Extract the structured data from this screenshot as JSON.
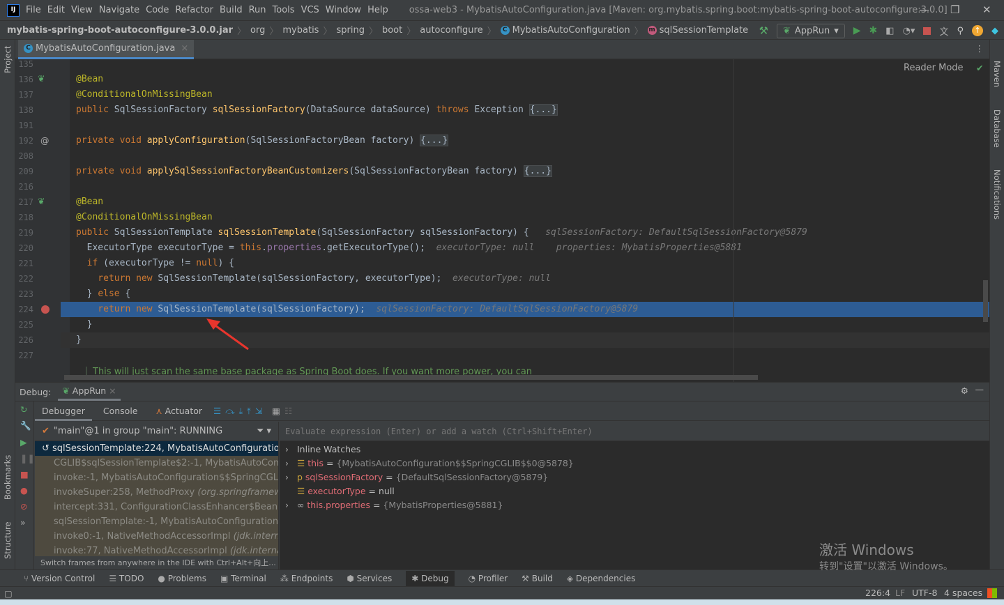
{
  "window": {
    "title": "ossa-web3 - MybatisAutoConfiguration.java [Maven: org.mybatis.spring.boot:mybatis-spring-boot-autoconfigure:3.0.0]",
    "logo": "IJ"
  },
  "menu": [
    "File",
    "Edit",
    "View",
    "Navigate",
    "Code",
    "Refactor",
    "Build",
    "Run",
    "Tools",
    "VCS",
    "Window",
    "Help"
  ],
  "breadcrumb": [
    "mybatis-spring-boot-autoconfigure-3.0.0.jar",
    "org",
    "mybatis",
    "spring",
    "boot",
    "autoconfigure",
    "MybatisAutoConfiguration",
    "sqlSessionTemplate"
  ],
  "run_config": "AppRun",
  "editor": {
    "tab": "MybatisAutoConfiguration.java",
    "reader_mode": "Reader Mode",
    "lines": [
      {
        "n": "135",
        "t": []
      },
      {
        "n": "136",
        "t": [
          [
            "ann",
            "@Bean"
          ]
        ]
      },
      {
        "n": "137",
        "t": [
          [
            "ann",
            "@ConditionalOnMissingBean"
          ]
        ]
      },
      {
        "n": "138",
        "t": [
          [
            "kw",
            "public "
          ],
          [
            "pl",
            "SqlSessionFactory "
          ],
          [
            "fn",
            "sqlSessionFactory"
          ],
          [
            "pl",
            "(DataSource dataSource) "
          ],
          [
            "kw",
            "throws "
          ],
          [
            "pl",
            "Exception "
          ],
          [
            "fold",
            "{...}"
          ]
        ]
      },
      {
        "n": "191",
        "t": []
      },
      {
        "n": "192",
        "t": [
          [
            "kw",
            "private void "
          ],
          [
            "fn",
            "applyConfiguration"
          ],
          [
            "pl",
            "(SqlSessionFactoryBean factory) "
          ],
          [
            "fold",
            "{...}"
          ]
        ]
      },
      {
        "n": "208",
        "t": []
      },
      {
        "n": "209",
        "t": [
          [
            "kw",
            "private void "
          ],
          [
            "fn",
            "applySqlSessionFactoryBeanCustomizers"
          ],
          [
            "pl",
            "(SqlSessionFactoryBean factory) "
          ],
          [
            "fold",
            "{...}"
          ]
        ]
      },
      {
        "n": "216",
        "t": []
      },
      {
        "n": "217",
        "t": [
          [
            "ann",
            "@Bean"
          ]
        ]
      },
      {
        "n": "218",
        "t": [
          [
            "ann",
            "@ConditionalOnMissingBean"
          ]
        ]
      },
      {
        "n": "219",
        "t": [
          [
            "kw",
            "public "
          ],
          [
            "pl",
            "SqlSessionTemplate "
          ],
          [
            "fn",
            "sqlSessionTemplate"
          ],
          [
            "pl",
            "(SqlSessionFactory sqlSessionFactory) {   "
          ],
          [
            "hint",
            "sqlSessionFactory: DefaultSqlSessionFactory@5879"
          ]
        ]
      },
      {
        "n": "220",
        "t": [
          [
            "pl",
            "  ExecutorType executorType = "
          ],
          [
            "kw",
            "this"
          ],
          [
            "pl",
            "."
          ],
          [
            "fld",
            "properties"
          ],
          [
            "pl",
            ".getExecutorType();  "
          ],
          [
            "kw",
            ""
          ],
          [
            "hint",
            "executorType: null    properties: MybatisProperties@5881"
          ]
        ]
      },
      {
        "n": "221",
        "t": [
          [
            "kw",
            "  if "
          ],
          [
            "pl",
            "(executorType != "
          ],
          [
            "kw",
            "null"
          ],
          [
            "pl",
            ") {"
          ]
        ]
      },
      {
        "n": "222",
        "t": [
          [
            "kw",
            "    return new "
          ],
          [
            "pl",
            "SqlSessionTemplate(sqlSessionFactory, executorType);  "
          ],
          [
            "hint",
            "executorType: null"
          ]
        ]
      },
      {
        "n": "223",
        "t": [
          [
            "pl",
            "  } "
          ],
          [
            "kw",
            "else "
          ],
          [
            "pl",
            "{"
          ]
        ]
      },
      {
        "n": "224",
        "t": [
          [
            "kw",
            "    return new "
          ],
          [
            "pl",
            "SqlSessionTemplate(sqlSessionFactory);  "
          ],
          [
            "hint",
            "sqlSessionFactory: DefaultSqlSessionFactory@5879"
          ]
        ]
      },
      {
        "n": "225",
        "t": [
          [
            "pl",
            "  }"
          ]
        ]
      },
      {
        "n": "226",
        "t": [
          [
            "pl",
            "}"
          ]
        ]
      },
      {
        "n": "227",
        "t": []
      }
    ],
    "doc_comment": "This will just scan the same base package as Spring Boot does. If you want more power, you can"
  },
  "debug": {
    "label": "Debug:",
    "session": "AppRun",
    "tabs": [
      "Debugger",
      "Console",
      "Actuator"
    ],
    "thread": "\"main\"@1 in group \"main\": RUNNING",
    "frames": [
      [
        "sqlSessionTemplate:224, MybatisAutoConfiguration ",
        "(org"
      ],
      [
        "CGLIB$sqlSessionTemplate$2:-1, MybatisAutoConfigura",
        ""
      ],
      [
        "invoke:-1, MybatisAutoConfiguration$$SpringCGLIB$$2",
        ""
      ],
      [
        "invokeSuper:258, MethodProxy ",
        "(org.springframework.c"
      ],
      [
        "intercept:331, ConfigurationClassEnhancer$BeanMethoc",
        ""
      ],
      [
        "sqlSessionTemplate:-1, MybatisAutoConfiguration$$Spr",
        ""
      ],
      [
        "invoke0:-1, NativeMethodAccessorImpl ",
        "(jdk.internal.refl"
      ],
      [
        "invoke:77, NativeMethodAccessorImpl ",
        "(jdk.internal.refle"
      ]
    ],
    "frames_hint": "Switch frames from anywhere in the IDE with Ctrl+Alt+向上...",
    "eval_placeholder": "Evaluate expression (Enter) or add a watch (Ctrl+Shift+Enter)",
    "variables": [
      {
        "name": "Inline Watches",
        "value": "",
        "kind": "group"
      },
      {
        "name": "this",
        "value": "{MybatisAutoConfiguration$$SpringCGLIB$$0@5878}",
        "kind": "field"
      },
      {
        "name": "sqlSessionFactory",
        "value": "{DefaultSqlSessionFactory@5879}",
        "kind": "param"
      },
      {
        "name": "executorType",
        "value": "null",
        "kind": "field"
      },
      {
        "name": "this.properties",
        "value": "{MybatisProperties@5881}",
        "kind": "watch"
      }
    ]
  },
  "tool_windows_left": [
    "Project",
    "Bookmarks",
    "Structure"
  ],
  "tool_windows_right": [
    "Maven",
    "Database",
    "Notifications"
  ],
  "bottom_tools": [
    "Version Control",
    "TODO",
    "Problems",
    "Terminal",
    "Endpoints",
    "Services",
    "Debug",
    "Profiler",
    "Build",
    "Dependencies"
  ],
  "status": {
    "position": "226:4",
    "line_sep": "LF",
    "encoding": "UTF-8",
    "indent": "4 spaces"
  },
  "watermark": {
    "title": "激活 Windows",
    "subtitle": "转到\"设置\"以激活 Windows。"
  }
}
